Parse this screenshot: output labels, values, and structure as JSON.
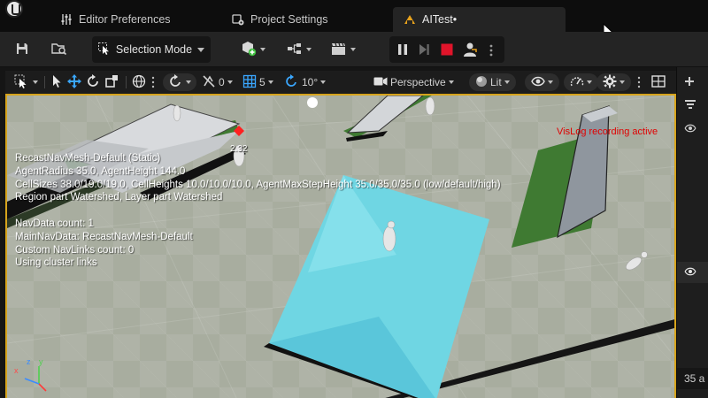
{
  "tabs": [
    {
      "label": "Editor Preferences",
      "icon": "sliders-icon"
    },
    {
      "label": "Project Settings",
      "icon": "project-settings-icon"
    },
    {
      "label": "AITest•",
      "icon": "level-icon"
    }
  ],
  "toolbar": {
    "selection_mode_label": "Selection Mode"
  },
  "viewport_toolbar": {
    "rotation_snap_value": "0",
    "grid_snap_value": "5",
    "angle_snap_value": "10°",
    "view_mode_label": "Perspective",
    "lighting_label": "Lit"
  },
  "viewport": {
    "stats_lines": [
      "RecastNavMesh-Default (Static)",
      "AgentRadius 35.0, AgentHeight 144.0",
      "CellSizes 38.0/19.0/19.0, CellHeights 10.0/10.0/10.0, AgentMaxStepHeight 35.0/35.0/35.0 (low/default/high)",
      "Region part Watershed, Layer part Watershed",
      "",
      "NavData count: 1",
      "MainNavData: RecastNavMesh-Default",
      "Custom NavLinks count: 0",
      "Using cluster links"
    ],
    "vislog_status": "VisLog recording active",
    "ai_debug_label": "2.32"
  },
  "right_panel": {
    "value_label": "35 a"
  },
  "colors": {
    "accent": "#d6a31c",
    "record_red": "#e0142a",
    "vislog_red": "#e00000",
    "water": "#5fd0e0",
    "navmesh_green": "#3f7a32"
  }
}
